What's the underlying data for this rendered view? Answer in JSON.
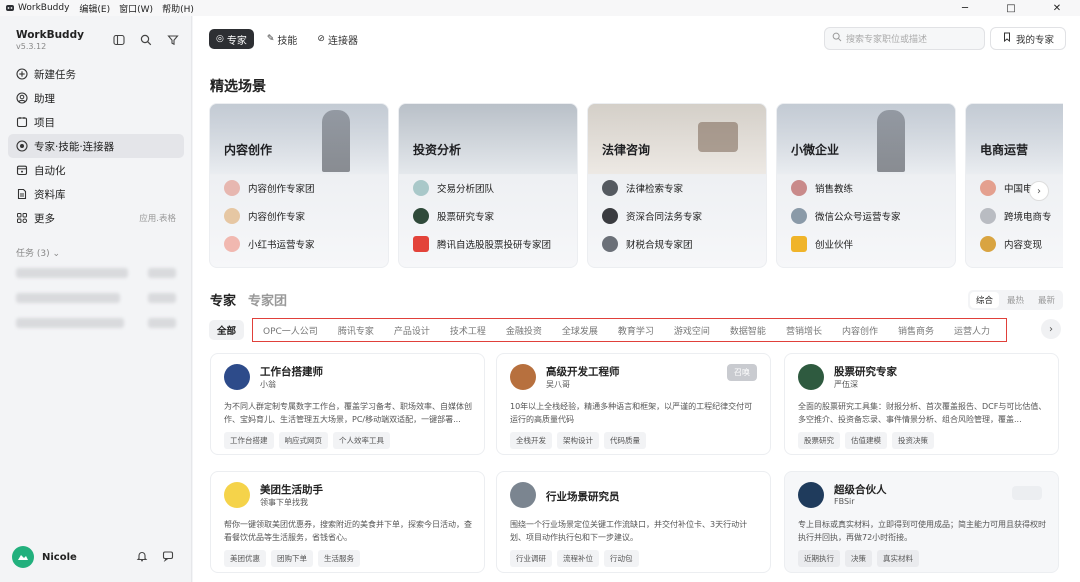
{
  "titlebar": {
    "app_name": "WorkBuddy",
    "menus": [
      "编辑(E)",
      "窗口(W)",
      "帮助(H)"
    ]
  },
  "sidebar": {
    "brand": "WorkBuddy",
    "version": "v5.3.12",
    "nav": [
      {
        "label": "新建任务",
        "icon": "plus-circle-icon"
      },
      {
        "label": "助理",
        "icon": "assistant-icon"
      },
      {
        "label": "项目",
        "icon": "project-icon"
      },
      {
        "label": "专家·技能·连接器",
        "icon": "expert-icon",
        "active": true
      },
      {
        "label": "自动化",
        "icon": "calendar-icon"
      },
      {
        "label": "资料库",
        "icon": "library-icon"
      },
      {
        "label": "更多",
        "icon": "grid-icon",
        "hint": "应用.表格"
      }
    ],
    "tasks_header": "任务 (3)",
    "user_name": "Nicole"
  },
  "main": {
    "tabs": [
      {
        "label": "专家",
        "icon": "expert-icon",
        "active": true
      },
      {
        "label": "技能",
        "icon": "skill-icon"
      },
      {
        "label": "连接器",
        "icon": "link-icon"
      }
    ],
    "search_placeholder": "搜索专家职位或描述",
    "my_experts": "我的专家",
    "featured_title": "精选场景",
    "scenes": [
      {
        "title": "内容创作",
        "items": [
          "内容创作专家团",
          "内容创作专家",
          "小红书运营专家"
        ]
      },
      {
        "title": "投资分析",
        "items": [
          "交易分析团队",
          "股票研究专家",
          "腾讯自选股股票投研专家团"
        ]
      },
      {
        "title": "法律咨询",
        "items": [
          "法律检索专家",
          "资深合同法务专家",
          "财税合规专家团"
        ]
      },
      {
        "title": "小微企业",
        "items": [
          "销售教练",
          "微信公众号运营专家",
          "创业伙伴"
        ]
      },
      {
        "title": "电商运营",
        "items": [
          "中国电",
          "跨境电商专",
          "内容变现"
        ]
      }
    ],
    "list_tabs": {
      "active": "专家",
      "inactive": "专家团"
    },
    "sort": [
      "综合",
      "最热",
      "最新"
    ],
    "category_all": "全部",
    "categories": [
      "OPC一人公司",
      "腾讯专家",
      "产品设计",
      "技术工程",
      "金融投资",
      "全球发展",
      "教育学习",
      "游戏空间",
      "数据智能",
      "营销增长",
      "内容创作",
      "销售商务",
      "运营人力"
    ],
    "cards": [
      {
        "title": "工作台搭建师",
        "sub": "小翁",
        "desc": "为不同人群定制专属数字工作台，覆盖学习备考、职场效率、自媒体创作、宝妈育儿、生活管理五大场景，PC/移动端双适配，一键部署...",
        "tags": [
          "工作台搭建",
          "响应式网页",
          "个人效率工具"
        ]
      },
      {
        "title": "高级开发工程师",
        "sub": "吴八哥",
        "desc": "10年以上全栈经验，精通多种语言和框架，以严谨的工程纪律交付可运行的高质量代码",
        "tags": [
          "全栈开发",
          "架构设计",
          "代码质量"
        ],
        "badge": "召唤"
      },
      {
        "title": "股票研究专家",
        "sub": "严伍深",
        "desc": "全面的股票研究工具集：财报分析、首次覆盖报告、DCF与可比估值、多空推介、投资备忘录、事件情景分析、组合风险管理，覆盖...",
        "tags": [
          "股票研究",
          "估值建模",
          "投资决策"
        ]
      },
      {
        "title": "美团生活助手",
        "sub": "领事下单找我",
        "desc": "帮你一键领取美团优惠券，搜索附近的美食并下单，探索今日活动，查看餐饮优品等生活服务，省钱省心。",
        "tags": [
          "美团优惠",
          "团购下单",
          "生活服务"
        ]
      },
      {
        "title": "行业场景研究员",
        "sub": "",
        "desc": "围绕一个行业场景定位关键工作流缺口，并交付补位卡、3天行动计划、项目动作执行包和下一步建议。",
        "tags": [
          "行业调研",
          "流程补位",
          "行动包"
        ]
      },
      {
        "title": "超级合伙人",
        "sub": "FBSir",
        "desc": "专上目标或真实材料，立即得到可使用成品；简主能力可用且获得权时执行并回执，再做72小时衔接。",
        "tags": [
          "近期执行",
          "决策",
          "真实材料"
        ],
        "gray": true
      }
    ]
  },
  "colors": {
    "accent_dark": "#2d2f33",
    "highlight_border": "#e0403a",
    "avatar_green": "#22b07d"
  }
}
